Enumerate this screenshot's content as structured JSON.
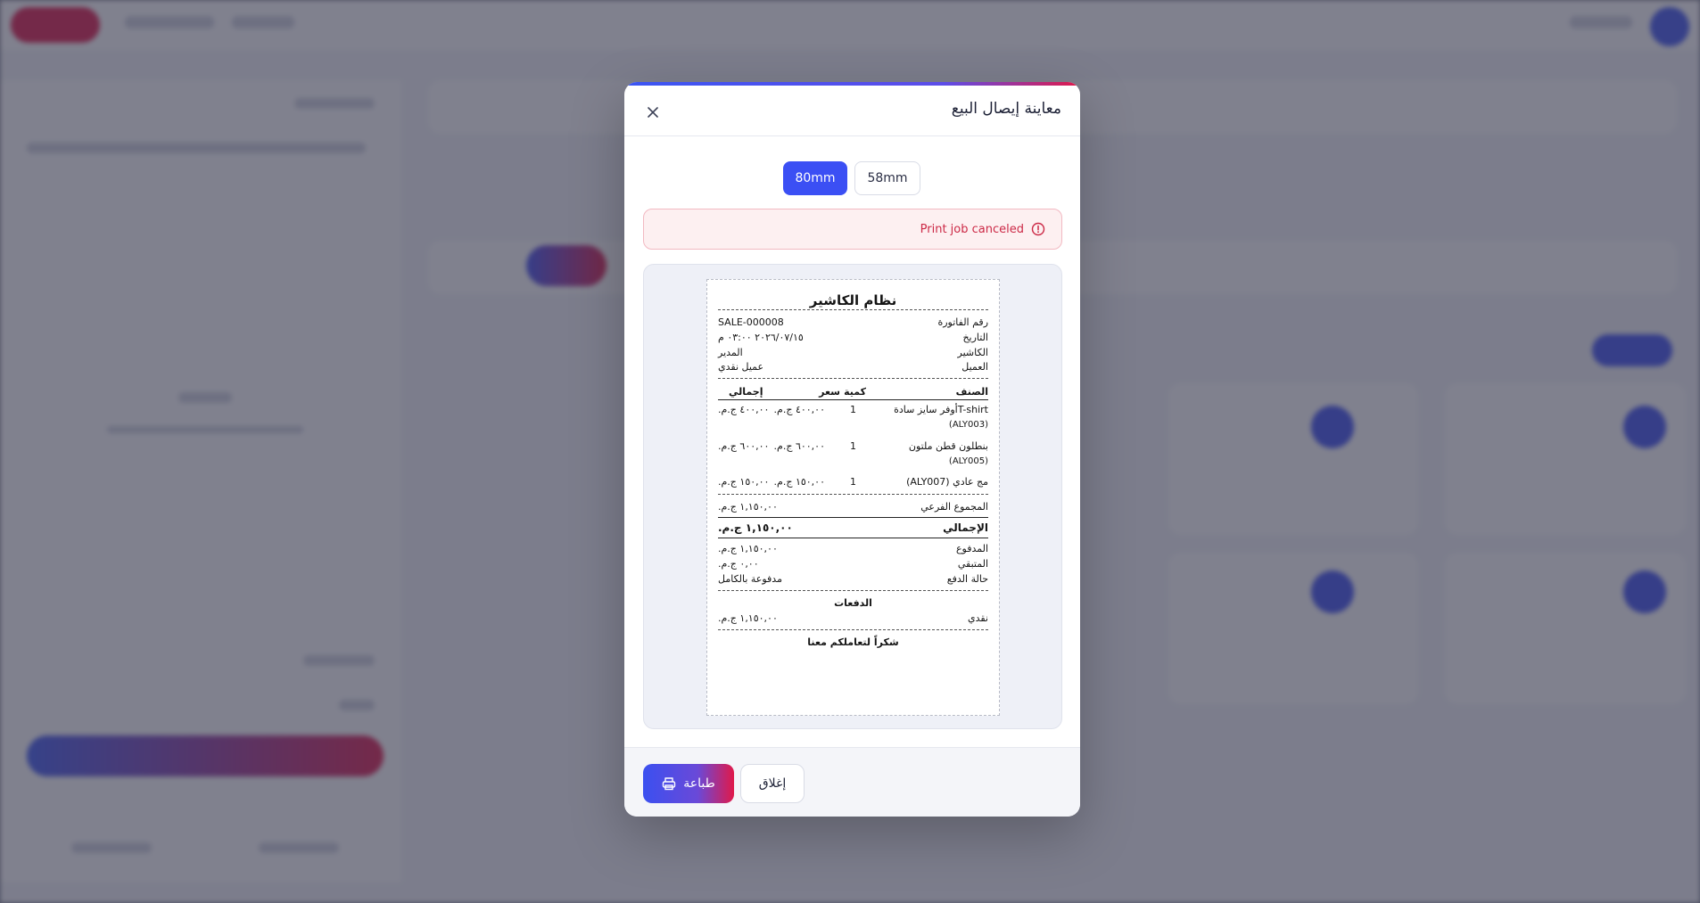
{
  "modal": {
    "title": "معاينة إيصال البيع",
    "close_icon": "close-icon"
  },
  "paper_sizes": {
    "options": [
      "80mm",
      "58mm"
    ],
    "selected": "80mm"
  },
  "alert": {
    "text": "Print job canceled",
    "icon": "alert-circle-icon"
  },
  "receipt": {
    "store_name": "نظام الكاشير",
    "info": [
      {
        "label": "رقم الفاتورة",
        "value": "SALE-000008"
      },
      {
        "label": "التاريخ",
        "value": "٢٠٢٦/٠٧/١٥ ٠٣:٠٠ م"
      },
      {
        "label": "الكاشير",
        "value": "المدير"
      },
      {
        "label": "العميل",
        "value": "عميل نقدي"
      }
    ],
    "columns": {
      "item": "الصنف",
      "qty": "كمية",
      "price": "سعر",
      "total": "إجمالي"
    },
    "items": [
      {
        "name": "T-shirtأوفر سايز سادة",
        "sku": "(ALY003)",
        "qty": "1",
        "price": "٤٠٠,٠٠ ج.م.",
        "total": "٤٠٠,٠٠ ج.م."
      },
      {
        "name": "بنطلون قطن ملتون",
        "sku": "(ALY005)",
        "qty": "1",
        "price": "٦٠٠,٠٠ ج.م.",
        "total": "٦٠٠,٠٠ ج.م."
      },
      {
        "name": "مج عادي (ALY007)",
        "sku": "",
        "qty": "1",
        "price": "١٥٠,٠٠ ج.م.",
        "total": "١٥٠,٠٠ ج.م."
      }
    ],
    "subtotal": {
      "label": "المجموع الفرعي",
      "value": "١,١٥٠,٠٠ ج.م."
    },
    "total": {
      "label": "الإجمالي",
      "value": "١,١٥٠,٠٠ ج.م."
    },
    "paid": {
      "label": "المدفوع",
      "value": "١,١٥٠,٠٠ ج.م."
    },
    "remaining": {
      "label": "المتبقي",
      "value": "٠,٠٠ ج.م."
    },
    "payment_status": {
      "label": "حالة الدفع",
      "value": "مدفوعة بالكامل"
    },
    "payments_title": "الدفعات",
    "payments": [
      {
        "method": "نقدي",
        "amount": "١,١٥٠,٠٠ ج.م."
      }
    ],
    "thanks": "شكراً لتعاملكم معنا"
  },
  "footer": {
    "print_label": "طباعة",
    "print_icon": "printer-icon",
    "close_label": "إغلاق"
  },
  "colors": {
    "primary": "#3b4ff4",
    "accent": "#e0194a",
    "alert_text": "#cc2946"
  }
}
